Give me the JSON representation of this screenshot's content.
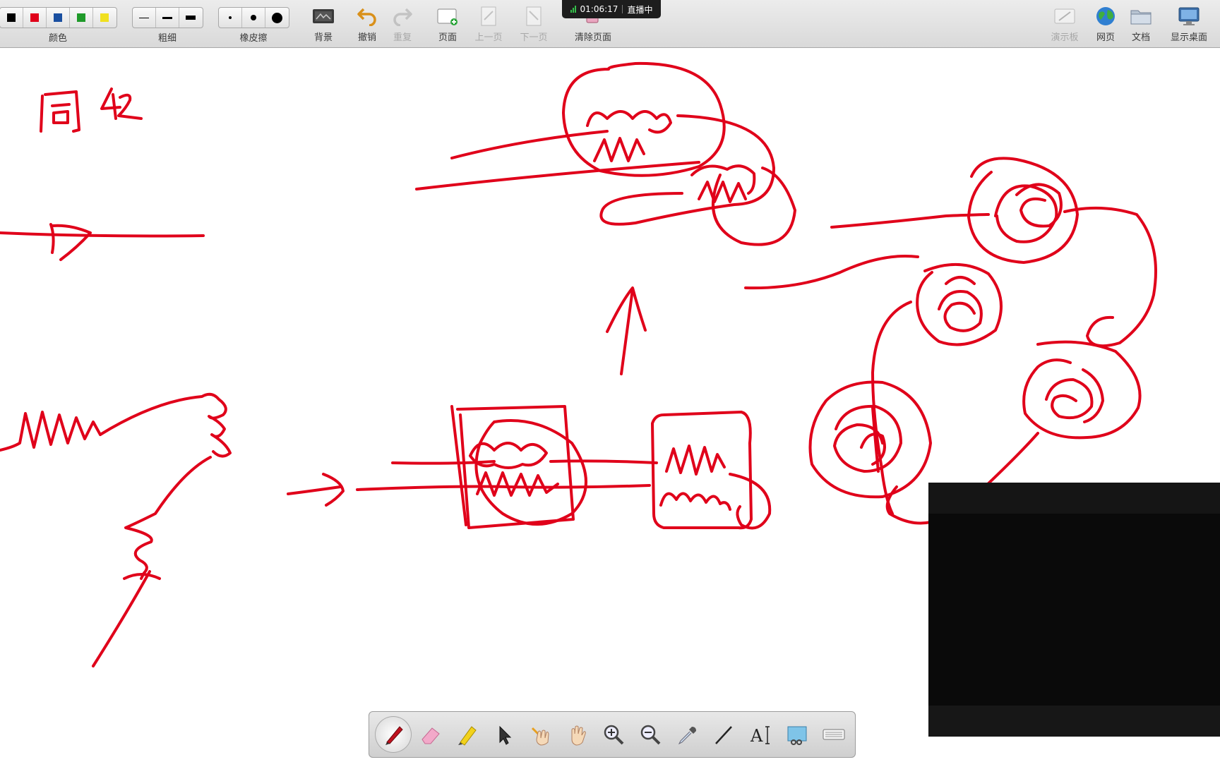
{
  "toolbar": {
    "color_group": {
      "label": "颜色",
      "swatches": [
        "#000000",
        "#e0001a",
        "#1a4fa0",
        "#1f9a2a",
        "#f0e020"
      ]
    },
    "thickness_label": "粗细",
    "eraser_label": "橡皮擦",
    "background_label": "背景",
    "undo_label": "撤销",
    "redo_label": "重复",
    "page_label": "页面",
    "prev_page_label": "上一页",
    "next_page_label": "下一页",
    "clear_page_label": "清除页面",
    "live": {
      "time": "01:06:17",
      "status": "直播中"
    },
    "demo_board_label": "演示板",
    "web_label": "网页",
    "docs_label": "文档",
    "desktop_label": "显示桌面"
  },
  "canvas": {
    "ink_color": "#e0001a",
    "handwritten_text": "同42"
  },
  "palette": {
    "tools": [
      "pen-icon",
      "eraser-icon",
      "highlighter-icon",
      "pointer-icon",
      "laser-hand-icon",
      "hand-icon",
      "zoom-in-icon",
      "zoom-out-icon",
      "eyedropper-icon",
      "line-icon",
      "text-icon",
      "screenshot-icon",
      "keyboard-icon"
    ]
  }
}
